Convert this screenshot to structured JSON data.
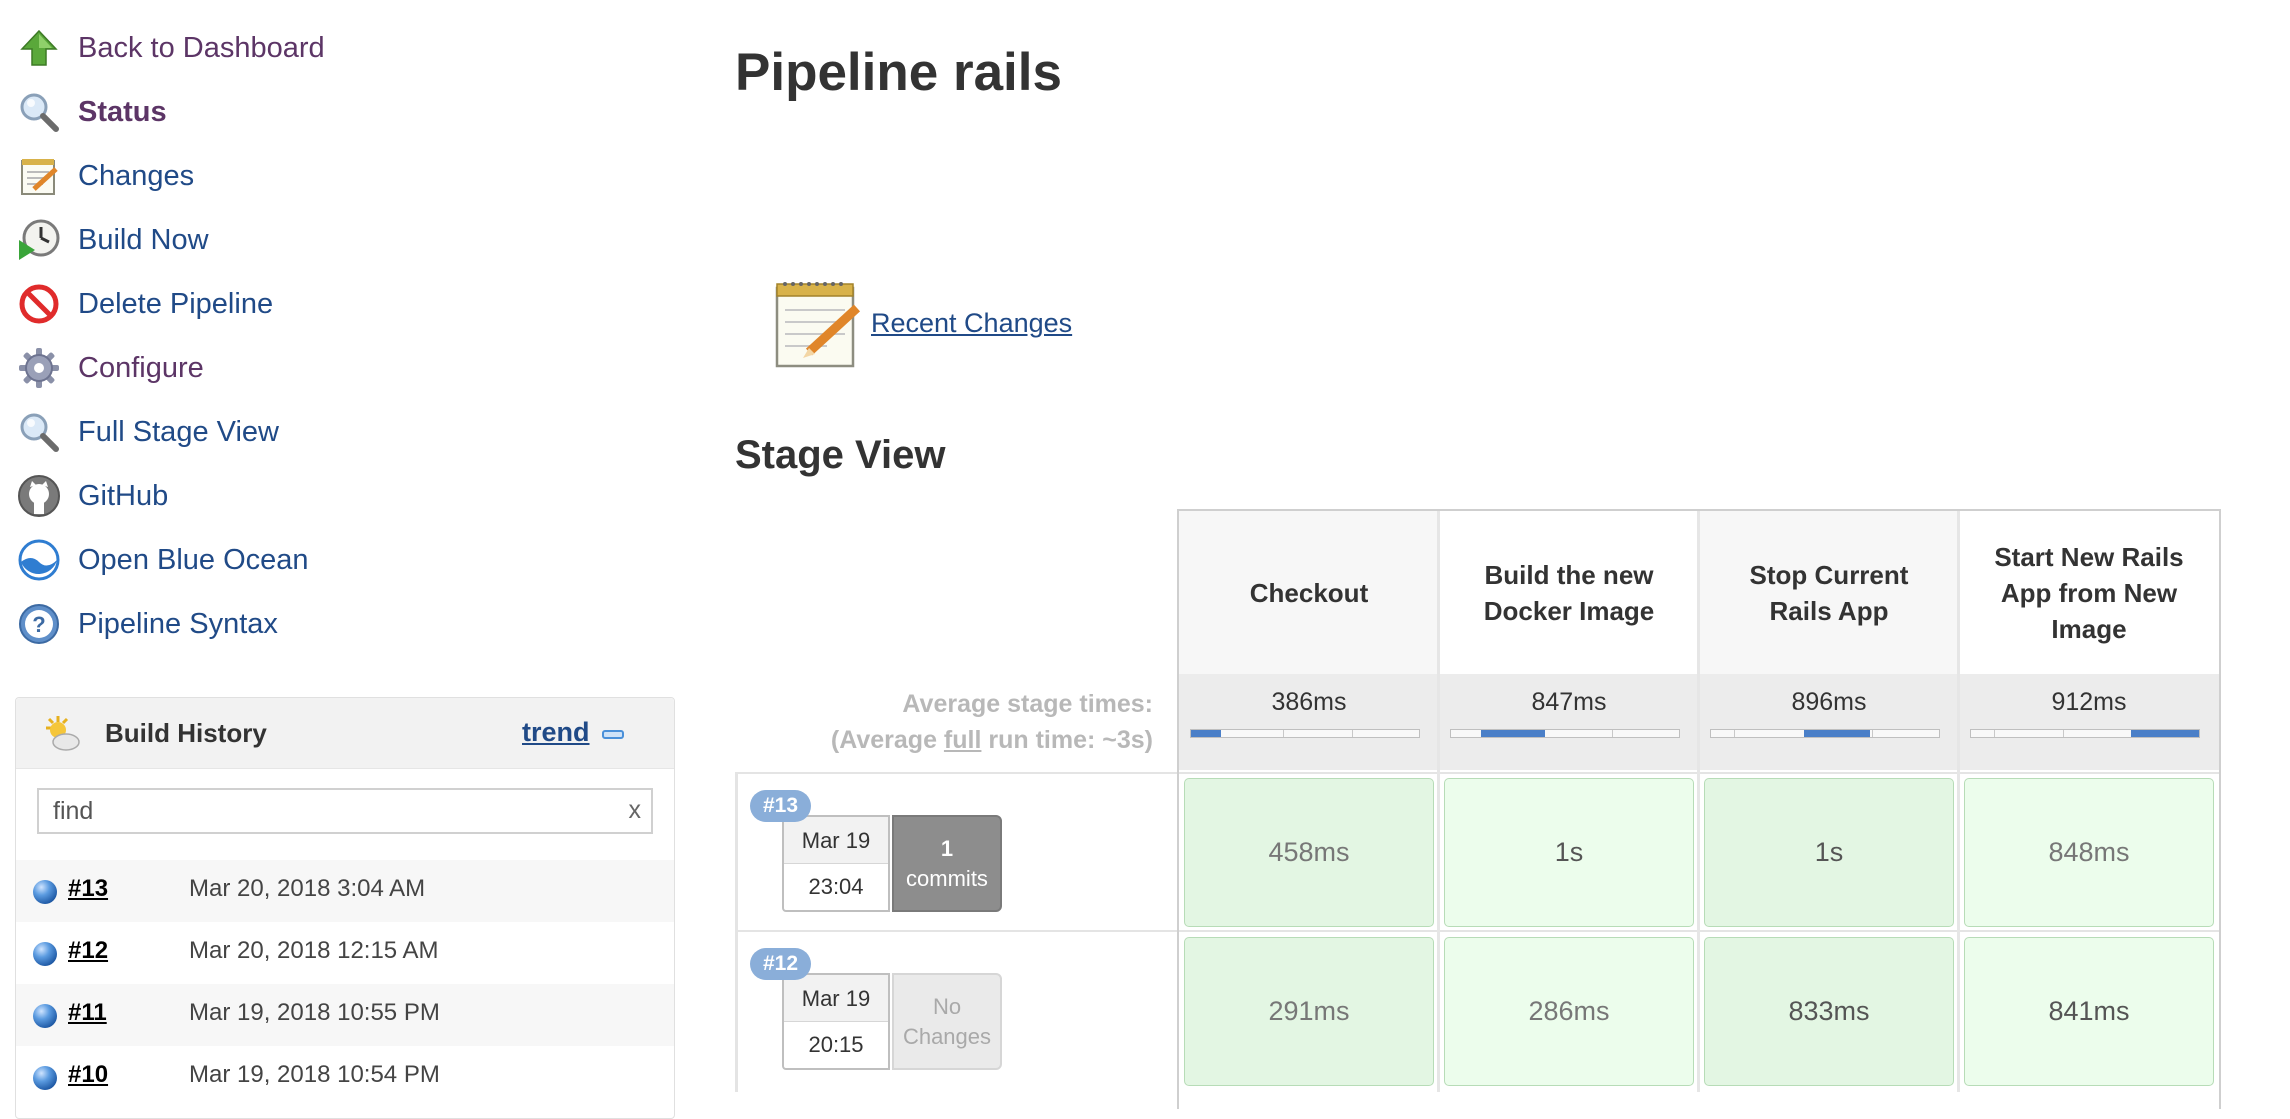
{
  "sidebar": {
    "tasks": [
      {
        "label": "Back to Dashboard",
        "icon": "up-arrow-icon"
      },
      {
        "label": "Status",
        "icon": "magnifier-icon"
      },
      {
        "label": "Changes",
        "icon": "notepad-icon"
      },
      {
        "label": "Build Now",
        "icon": "clock-play-icon"
      },
      {
        "label": "Delete Pipeline",
        "icon": "no-entry-icon"
      },
      {
        "label": "Configure",
        "icon": "gear-icon"
      },
      {
        "label": "Full Stage View",
        "icon": "magnifier-icon"
      },
      {
        "label": "GitHub",
        "icon": "github-icon"
      },
      {
        "label": "Open Blue Ocean",
        "icon": "blue-ocean-icon"
      },
      {
        "label": "Pipeline Syntax",
        "icon": "help-icon"
      }
    ]
  },
  "build_history": {
    "title": "Build History",
    "trend_label": "trend",
    "search_placeholder": "find",
    "clear_label": "x",
    "builds": [
      {
        "number": "#13",
        "date": "Mar 20, 2018 3:04 AM"
      },
      {
        "number": "#12",
        "date": "Mar 20, 2018 12:15 AM"
      },
      {
        "number": "#11",
        "date": "Mar 19, 2018 10:55 PM"
      },
      {
        "number": "#10",
        "date": "Mar 19, 2018 10:54 PM"
      }
    ]
  },
  "main": {
    "title": "Pipeline rails",
    "recent_changes_label": "Recent Changes",
    "stage_view_title": "Stage View",
    "avg_label_line1": "Average stage times:",
    "avg_label_line2_prefix": "(Average ",
    "avg_label_line2_full": "full",
    "avg_label_line2_suffix": " run time: ~3s)"
  },
  "stage_view": {
    "stages": [
      {
        "name": "Checkout",
        "avg": "386ms",
        "bar_start": 0.0,
        "bar_fraction": 0.13
      },
      {
        "name": "Build the new Docker Image",
        "avg": "847ms",
        "bar_start": 0.13,
        "bar_fraction": 0.28
      },
      {
        "name": "Stop Current Rails App",
        "avg": "896ms",
        "bar_start": 0.41,
        "bar_fraction": 0.29
      },
      {
        "name": "Start New Rails App from New Image",
        "avg": "912ms",
        "bar_start": 0.7,
        "bar_fraction": 0.3
      }
    ],
    "runs": [
      {
        "badge": "#13",
        "date": "Mar 19",
        "time": "23:04",
        "changes_count": "1",
        "changes_label": "commits",
        "has_changes": true,
        "durations": [
          "458ms",
          "1s",
          "1s",
          "848ms"
        ]
      },
      {
        "badge": "#12",
        "date": "Mar 19",
        "time": "20:15",
        "changes_count": "No",
        "changes_label": "Changes",
        "has_changes": false,
        "durations": [
          "291ms",
          "286ms",
          "833ms",
          "841ms"
        ]
      }
    ]
  }
}
